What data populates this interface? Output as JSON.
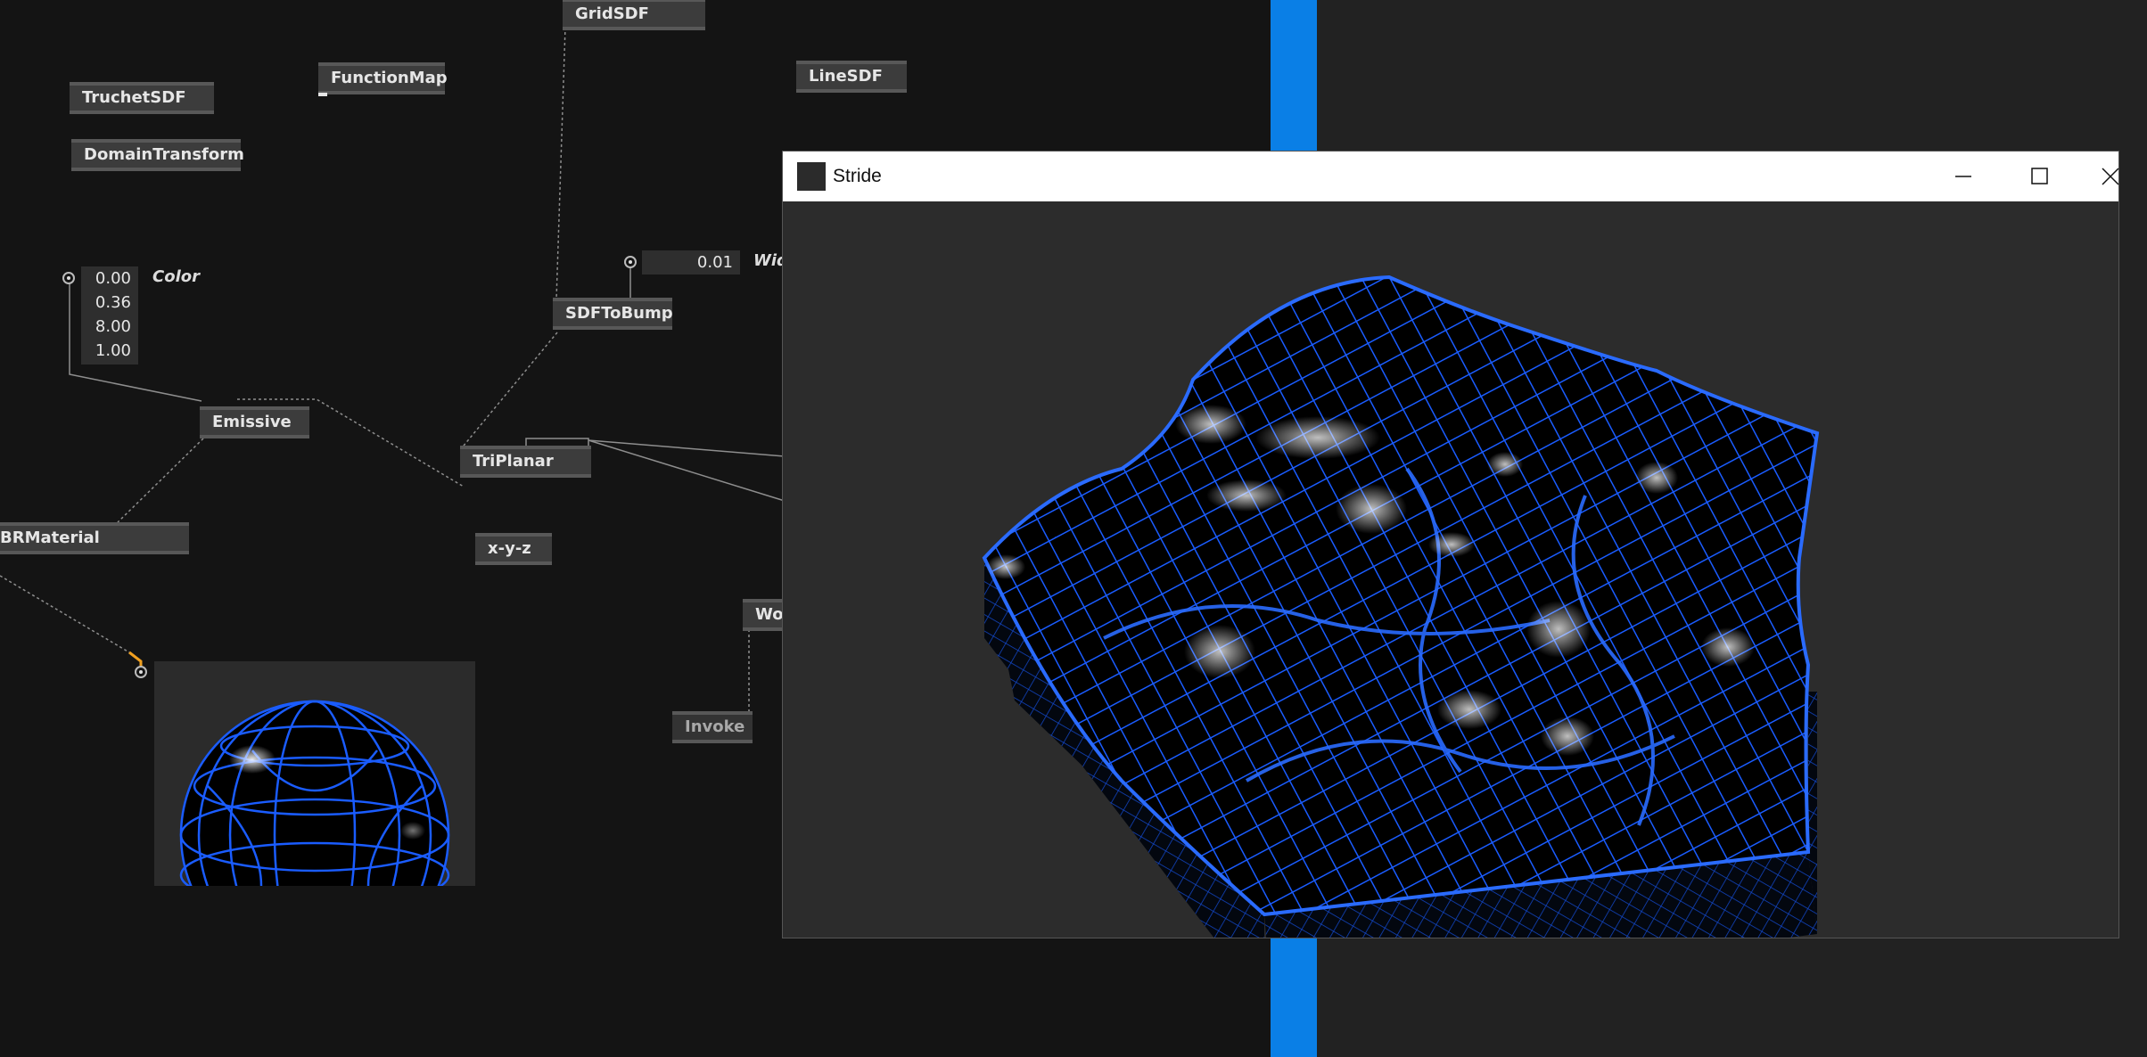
{
  "nodes": {
    "grid_sdf": "GridSDF",
    "function_map": "FunctionMap",
    "line_sdf": "LineSDF",
    "truchet_sdf": "TruchetSDF",
    "domain_transform": "DomainTransform",
    "sdf_to_bump": "SDFToBump",
    "emissive": "Emissive",
    "triplanar": "TriPlanar",
    "pbr_material": "BRMaterial",
    "xyz": "x-y-z",
    "wor": "Wor",
    "invoke": "Invoke"
  },
  "color_iobox": {
    "values": [
      "0.00",
      "0.36",
      "8.00",
      "1.00"
    ],
    "label": "Color"
  },
  "width_iobox": {
    "value": "0.01",
    "label": "Widt"
  },
  "window": {
    "title": "Stride",
    "icons": [
      "minimize-icon",
      "maximize-icon",
      "close-icon"
    ]
  },
  "colors": {
    "accent_blue": "#0a7fe6",
    "grid_blue": "#1a5cff",
    "patch_background": "#141414",
    "node_fill": "#3c3c3c",
    "link_highlight": "#f0a020"
  }
}
